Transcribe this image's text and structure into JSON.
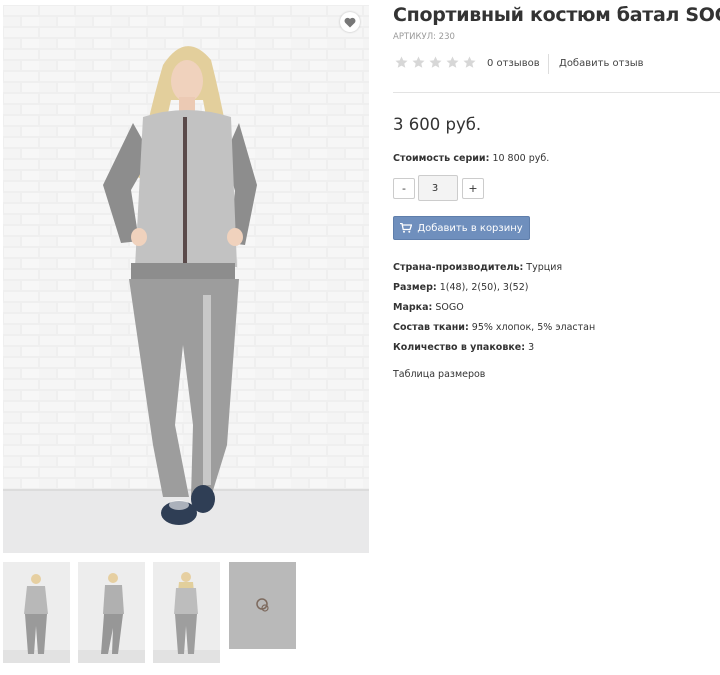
{
  "product": {
    "title": "Спортивный костюм батал SOGO",
    "sku": "АРТИКУЛ: 230",
    "rating": {
      "value": 0,
      "max": 5
    },
    "reviews_count": "0 отзывов",
    "add_review": "Добавить отзыв",
    "price": "3 600 руб.",
    "series_cost_label": "Стоимость серии:",
    "series_cost_value": "10 800 руб.",
    "quantity": {
      "minus": "-",
      "value": "3",
      "plus": "+"
    },
    "add_to_cart": "Добавить в корзину",
    "specs": [
      {
        "label": "Страна-производитель:",
        "value": "Турция"
      },
      {
        "label": "Размер:",
        "value": "1(48), 2(50), 3(52)"
      },
      {
        "label": "Марка:",
        "value": "SOGO"
      },
      {
        "label": "Состав ткани:",
        "value": "95% хлопок, 5% эластан"
      },
      {
        "label": "Количество в упаковке:",
        "value": "3"
      }
    ],
    "size_table_link": "Таблица размеров"
  },
  "gallery": {
    "main_image": "woman-in-grey-tracksuit-photo",
    "thumbnails": [
      "front-view",
      "side-view",
      "back-view",
      "fabric-detail"
    ]
  },
  "icons": {
    "favorite": "heart-icon",
    "rating_star": "star-icon",
    "cart": "cart-icon"
  },
  "colors": {
    "accent_button": "#6f8fbd",
    "star_empty": "#d7d7d7",
    "muted_text": "#9a9a9a"
  }
}
